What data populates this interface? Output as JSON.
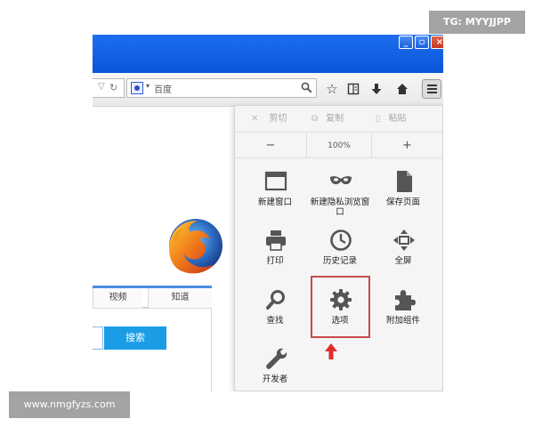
{
  "toolbar": {
    "search_engine": "百度"
  },
  "page": {
    "tabs": [
      "视频",
      "知道"
    ],
    "search_button": "搜索"
  },
  "menu_panel": {
    "edit": {
      "cut": "剪切",
      "copy": "复制",
      "paste": "粘贴"
    },
    "zoom": {
      "minus": "−",
      "level": "100%",
      "plus": "+"
    },
    "items": [
      {
        "label": "新建窗口",
        "icon": "new-window-icon"
      },
      {
        "label": "新建隐私浏览窗口",
        "icon": "private-mask-icon"
      },
      {
        "label": "保存页面",
        "icon": "save-page-icon"
      },
      {
        "label": "打印",
        "icon": "printer-icon"
      },
      {
        "label": "历史记录",
        "icon": "clock-history-icon"
      },
      {
        "label": "全屏",
        "icon": "fullscreen-icon"
      },
      {
        "label": "查找",
        "icon": "find-magnifier-icon"
      },
      {
        "label": "选项",
        "icon": "gear-options-icon"
      },
      {
        "label": "附加组件",
        "icon": "puzzle-addons-icon"
      },
      {
        "label": "开发者",
        "icon": "wrench-developer-icon"
      }
    ],
    "highlight_color": "#c84b4b"
  },
  "watermarks": {
    "top_right": "TG: MYYJJPP",
    "bottom_left": "www.nmgfyzs.com"
  },
  "colors": {
    "titlebar": "#1e6ef0",
    "search_button": "#1a9ce6",
    "watermark_bg": "#a3a3a3"
  }
}
